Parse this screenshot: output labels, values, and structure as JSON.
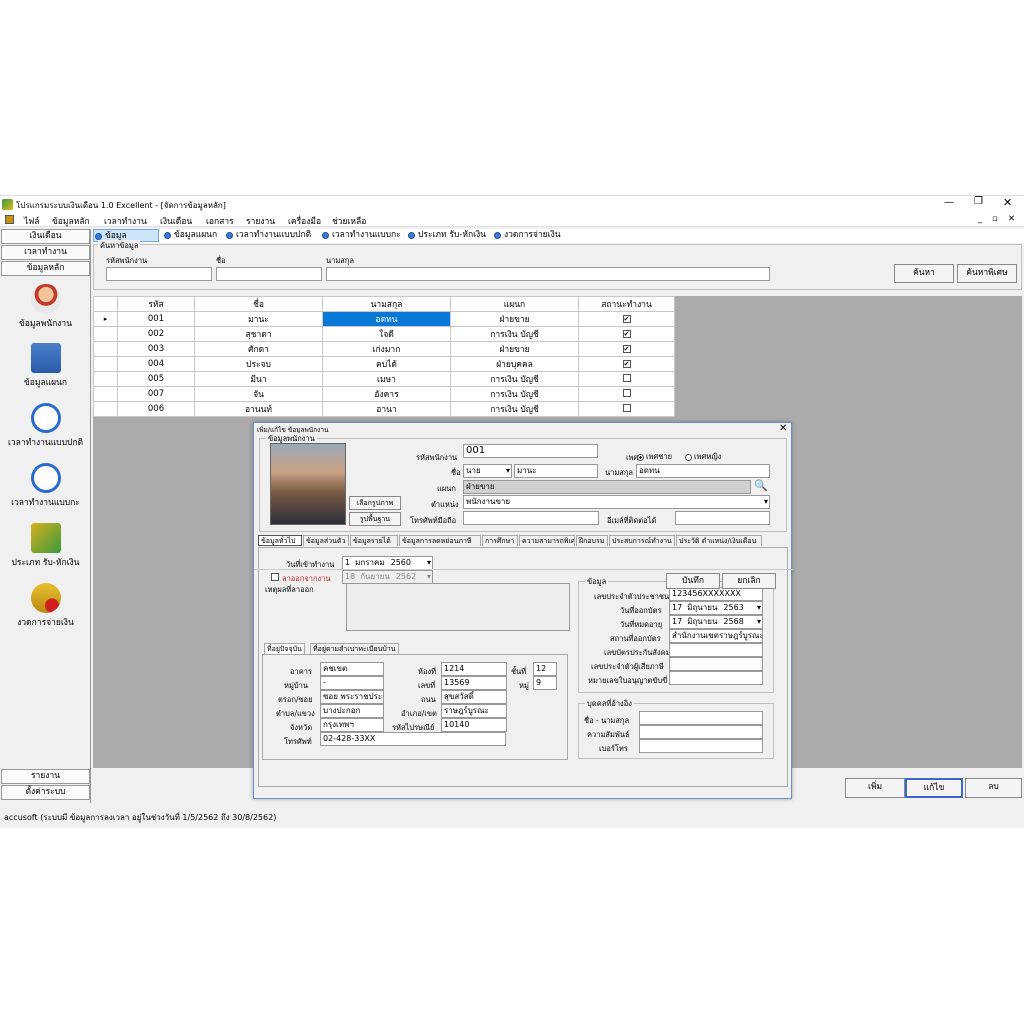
{
  "window": {
    "title": "โปรแกรมระบบเงินเดือน 1.0 Excellent - [จัดการข้อมูลหลัก]"
  },
  "menu": [
    "ไฟล์",
    "ข้อมูลหลัก",
    "เวลาทำงาน",
    "เงินเดือน",
    "เอกสาร",
    "รายงาน",
    "เครื่องมือ",
    "ช่วยเหลือ"
  ],
  "sidebar": {
    "top_buttons": [
      "เงินเดือน",
      "เวลาทำงาน",
      "ข้อมูลหลัก"
    ],
    "items": [
      "ข้อมูลพนักงาน",
      "ข้อมูลแผนก",
      "เวลาทำงานแบบปกติ",
      "เวลาทำงานแบบกะ",
      "ประเภท รับ-หักเงิน",
      "งวดการจ่ายเงิน"
    ],
    "bottom_buttons": [
      "รายงาน",
      "ตั้งค่าระบบ"
    ]
  },
  "tabs": [
    "ข้อมูลพนักงาน",
    "ข้อมูลแผนก",
    "เวลาทำงานแบบปกติ",
    "เวลาทำงานแบบกะ",
    "ประเภท รับ-หักเงิน",
    "งวดการจ่ายเงิน"
  ],
  "search": {
    "legend": "ค้นหาข้อมูล",
    "label_code": "รหัสพนักงาน",
    "label_name": "ชื่อ",
    "label_surname": "นามสกุล",
    "btn_search": "ค้นหา",
    "btn_advanced": "ค้นหาพิเศษ"
  },
  "grid": {
    "headers": [
      "รหัส",
      "ชื่อ",
      "นามสกุล",
      "แผนก",
      "สถานะทำงาน"
    ],
    "rows": [
      {
        "code": "001",
        "name": "มานะ",
        "surname": "อดทน",
        "dept": "ฝ่ายขาย",
        "active": true
      },
      {
        "code": "002",
        "name": "สุชาดา",
        "surname": "ใจดี",
        "dept": "การเงิน บัญชี",
        "active": true
      },
      {
        "code": "003",
        "name": "ศักดา",
        "surname": "เก่งมาก",
        "dept": "ฝ่ายขาย",
        "active": true
      },
      {
        "code": "004",
        "name": "ประจบ",
        "surname": "คบได้",
        "dept": "ฝ่ายบุคคล",
        "active": true
      },
      {
        "code": "005",
        "name": "มีนา",
        "surname": "เมษา",
        "dept": "การเงิน บัญชี",
        "active": false
      },
      {
        "code": "007",
        "name": "จัน",
        "surname": "อังคาร",
        "dept": "การเงิน บัญชี",
        "active": false
      },
      {
        "code": "006",
        "name": "อานนท์",
        "surname": "อานา",
        "dept": "การเงิน บัญชี",
        "active": false
      }
    ]
  },
  "dialog": {
    "title": "เพิ่ม/แก้ไข ข้อมูลพนักงาน",
    "group": "ข้อมูลพนักงาน",
    "btn_choose_photo": "เลือกรูปภาพ",
    "btn_default_photo": "รูปพื้นฐาน",
    "lbl_code": "รหัสพนักงาน",
    "code": "001",
    "lbl_gender": "เพศ",
    "gender_male": "เพศชาย",
    "gender_female": "เพศหญิง",
    "lbl_name": "ชื่อ",
    "prefix": "นาย",
    "name": "มานะ",
    "lbl_surname": "นามสกุล",
    "surname": "อดทน",
    "lbl_dept": "แผนก",
    "dept": "ฝ่ายขาย",
    "lbl_position": "ตำแหน่ง",
    "position": "พนักงานขาย",
    "lbl_mobile": "โทรศัพท์มือถือ",
    "lbl_email": "อีเมล์ที่ติดต่อได้",
    "subtabs": [
      "ข้อมูลทั่วไป",
      "ข้อมูลส่วนตัว",
      "ข้อมูลรายได้",
      "ข้อมูลการลดหย่อนภาษี",
      "การศึกษา",
      "ความสามารถพิเศษ",
      "ฝึกอบรม",
      "ประสบการณ์ทำงาน",
      "ประวัติ ตำแหน่ง/เงินเดือน"
    ],
    "lbl_start": "วันที่เข้าทำงาน",
    "start_day": "1",
    "start_month": "มกราคม",
    "start_year": "2560",
    "lbl_resign": "ลาออกจากงาน",
    "resign_day": "18",
    "resign_month": "กันยายน",
    "resign_year": "2562",
    "lbl_resign_reason": "เหตุผลที่ลาออก",
    "id_group": "ข้อมูล",
    "lbl_idcard": "เลขประจำตัวประชาชน",
    "idcard": "123456XXXXXXX",
    "lbl_issue": "วันที่ออกบัตร",
    "issue_day": "17",
    "issue_month": "มิถุนายน",
    "issue_year": "2563",
    "lbl_expire": "วันที่หมดอายุ",
    "expire_day": "17",
    "expire_month": "มิถุนายน",
    "expire_year": "2568",
    "lbl_issue_place": "สถานที่ออกบัตร",
    "issue_place": "สำนักงานเขตราษฎร์บูรณะ",
    "lbl_social": "เลขบัตรประกันสังคม",
    "lbl_tax": "เลขประจำตัวผู้เสียภาษี",
    "lbl_license": "หมายเลขใบอนุญาตขับขี่",
    "contact_group": "บุคคลที่อ้างอิง",
    "lbl_contact_name": "ชื่อ - นามสกุล",
    "lbl_relation": "ความสัมพันธ์",
    "lbl_phone": "เบอร์โทร",
    "addr_tabs": [
      "ที่อยู่ปัจจุบัน",
      "ที่อยู่ตามสำเนาทะเบียนบ้าน"
    ],
    "lbl_building": "อาคาร",
    "building": "คชเขต",
    "lbl_village": "หมู่บ้าน",
    "village": "-",
    "lbl_alley": "ตรอก/ซอย",
    "alley": "ซอย พระราชประเสริฐ",
    "lbl_subdistrict": "ตำบล/แขวง",
    "subdistrict": "บางปะกอก",
    "lbl_province": "จังหวัด",
    "province": "กรุงเทพฯ",
    "lbl_tel": "โทรศัพท์",
    "tel": "02-428-33XX",
    "lbl_room": "ห้องที่",
    "room": "1214",
    "lbl_floor": "ชั้นที่",
    "floor": "12",
    "lbl_houseno": "เลขที่",
    "houseno": "13569",
    "lbl_moo": "หมู่",
    "moo": "9",
    "lbl_road": "ถนน",
    "road": "สุขสวัสดิ์",
    "lbl_district": "อำเภอ/เขต",
    "district": "ราษฎร์บูรณะ",
    "lbl_zip": "รหัสไปรษณีย์",
    "zip": "10140",
    "btn_save": "บันทึก",
    "btn_cancel": "ยกเลิก"
  },
  "actions": {
    "add": "เพิ่ม",
    "edit": "แก้ไข",
    "delete": "ลบ"
  },
  "status": "accusoft (ระบบมี ข้อมูลการลงเวลา อยู่ในช่วงวันที่ 1/5/2562 ถึง 30/8/2562)"
}
